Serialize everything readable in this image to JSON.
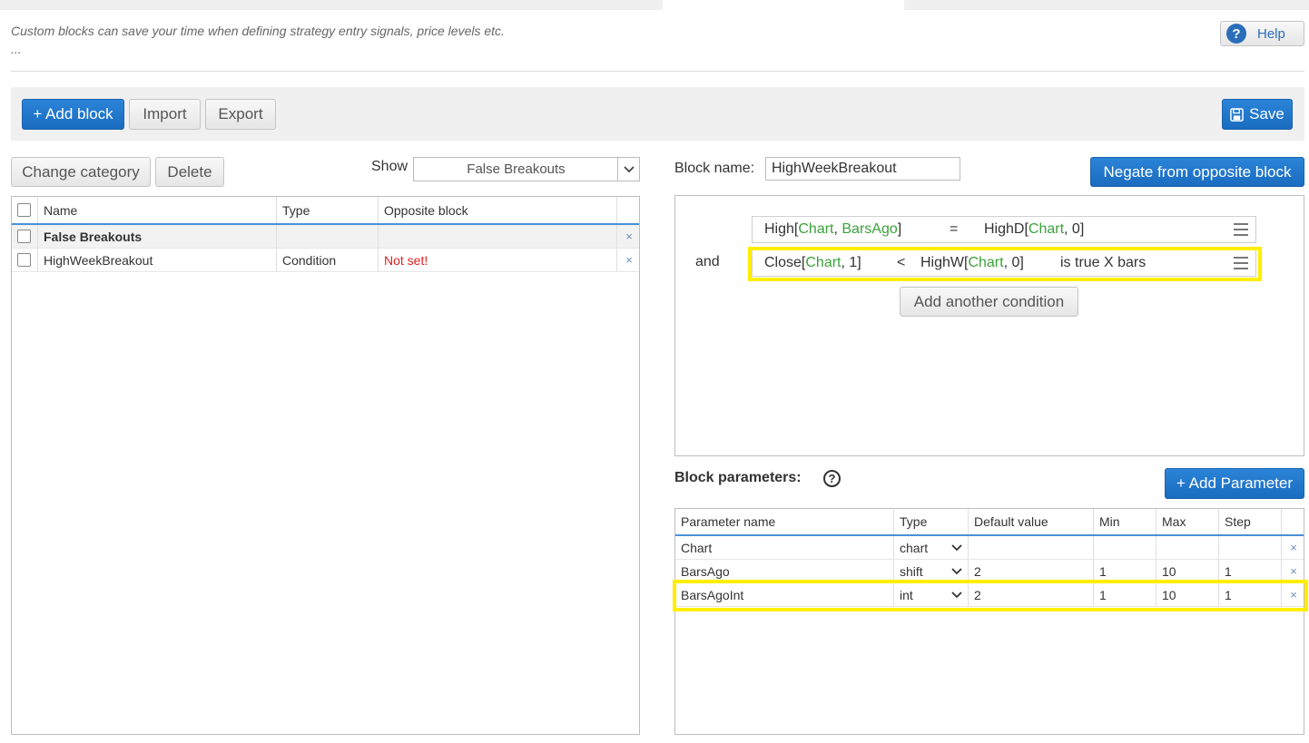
{
  "intro": {
    "line1": "Custom blocks can save your time when defining strategy entry signals, price levels etc.",
    "line2": "..."
  },
  "help": {
    "icon": "question-circle-icon",
    "label": "Help"
  },
  "toolbar": {
    "add_block": "+ Add block",
    "import": "Import",
    "export": "Export",
    "save": "Save",
    "save_icon": "floppy-disk-icon"
  },
  "left": {
    "change_category": "Change category",
    "delete": "Delete",
    "show_label": "Show",
    "show_value": "False Breakouts",
    "columns": [
      "Name",
      "Type",
      "Opposite block"
    ],
    "rows": [
      {
        "name": "False Breakouts",
        "type": "",
        "opposite": "",
        "bold": true
      },
      {
        "name": "HighWeekBreakout",
        "type": "Condition",
        "opposite": "Not set!"
      }
    ]
  },
  "right": {
    "block_name_label": "Block name:",
    "block_name_value": "HighWeekBreakout",
    "negate_button": "Negate from opposite block",
    "and_label": "and",
    "cond1": {
      "p1": "High[",
      "g1": "Chart",
      "p2": ", ",
      "g2": "BarsAgo",
      "p3": "]",
      "op": "=",
      "p4": "HighD[",
      "g3": "Chart",
      "p5": ", 0]"
    },
    "cond2": {
      "p1": "Close[",
      "g1": "Chart",
      "p2": ", 1]",
      "op": "<",
      "p3": "HighW[",
      "g2": "Chart",
      "p4": ", 0]",
      "tail": "is true X bars"
    },
    "add_condition": "Add another condition",
    "block_params_label": "Block parameters:",
    "add_parameter": "+ Add Parameter",
    "param_columns": [
      "Parameter name",
      "Type",
      "Default value",
      "Min",
      "Max",
      "Step"
    ],
    "params": [
      {
        "name": "Chart",
        "type": "chart",
        "default": "",
        "min": "",
        "max": "",
        "step": ""
      },
      {
        "name": "BarsAgo",
        "type": "shift",
        "default": "2",
        "min": "1",
        "max": "10",
        "step": "1"
      },
      {
        "name": "BarsAgoInt",
        "type": "int",
        "default": "2",
        "min": "1",
        "max": "10",
        "step": "1"
      }
    ]
  },
  "colors": {
    "primary": "#1a6cbf",
    "highlight": "#ffee00",
    "param_green": "#3aa23a",
    "error_red": "#e02020"
  }
}
